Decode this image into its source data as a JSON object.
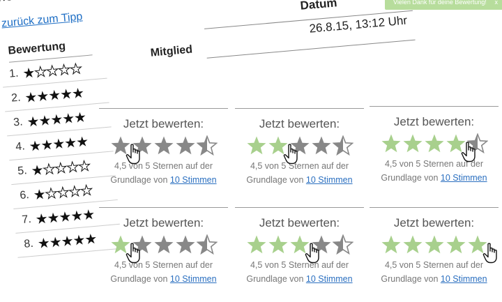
{
  "page": {
    "title_fragment": "me des Tipps",
    "back_link": "zurück zum Tipp"
  },
  "left_table": {
    "header": "Bewertung",
    "rows": [
      {
        "rank": "1.",
        "filled": 1
      },
      {
        "rank": "2.",
        "filled": 5
      },
      {
        "rank": "3.",
        "filled": 5
      },
      {
        "rank": "4.",
        "filled": 5
      },
      {
        "rank": "5.",
        "filled": 1
      },
      {
        "rank": "6.",
        "filled": 1
      },
      {
        "rank": "7.",
        "filled": 5
      },
      {
        "rank": "8.",
        "filled": 5
      }
    ]
  },
  "header": {
    "datum_label": "Datum",
    "mitglied_label": "Mitglied",
    "date_value": "26.8.15, 13:12 Uhr"
  },
  "toast": {
    "text": "Vielen Dank für deine Bewertung!",
    "close": "x"
  },
  "cards": [
    {
      "title": "Jetzt bewerten:",
      "info1": "4,5 von 5 Sternen auf der",
      "info2_prefix": "Grundlage von ",
      "link": "10 Stimmen",
      "hover": 0,
      "hover_color": "#a8d08d"
    },
    {
      "title": "Jetzt bewerten:",
      "info1": "4,5 von 5 Sternen auf der",
      "info2_prefix": "Grundlage von ",
      "link": "10 Stimmen",
      "hover": 2,
      "hover_color": "#a8d08d"
    },
    {
      "title": "Jetzt bewerten:",
      "info1": "4,5 von 5 Sternen auf der",
      "info2_prefix": "Grundlage von ",
      "link": "10 Stimmen",
      "hover": 4,
      "hover_color": "#a8d08d"
    },
    {
      "title": "Jetzt bewerten:",
      "info1": "4,5 von 5 Sternen auf der",
      "info2_prefix": "Grundlage von ",
      "link": "10 Stimmen",
      "hover": 1,
      "hover_color": "#a8d08d"
    },
    {
      "title": "Jetzt bewerten:",
      "info1": "4,5 von 5 Sternen auf der",
      "info2_prefix": "Grundlage von ",
      "link": "10 Stimmen",
      "hover": 3,
      "hover_color": "#a8d08d"
    },
    {
      "title": "Jetzt bewerten:",
      "info1": "4,5 von 5 Sternen auf der",
      "info2_prefix": "Grundlage von ",
      "link": "10 Stimmen",
      "hover": 5,
      "hover_color": "#a8d08d"
    }
  ],
  "colors": {
    "star_gray": "#888888",
    "star_green": "#a8d08d"
  },
  "rating_display": 4.5
}
